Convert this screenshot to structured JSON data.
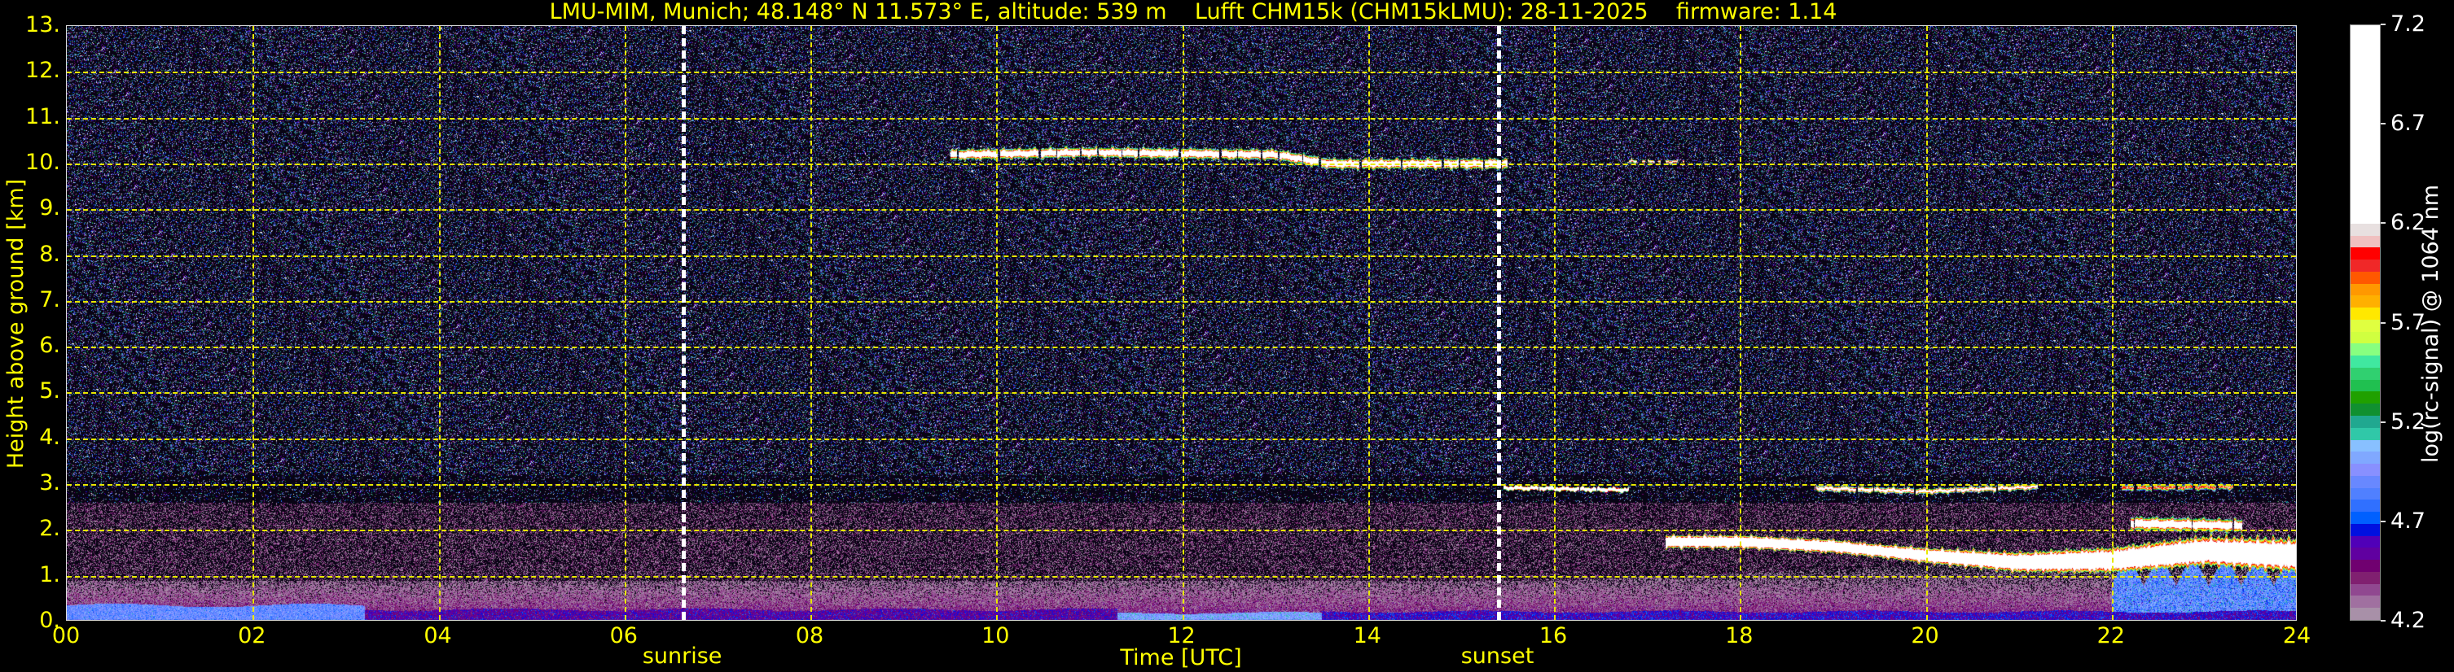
{
  "title": "LMU-MIM, Munich; 48.148° N 11.573° E, altitude: 539 m    Lufft CHM15k (CHM15kLMU): 28-11-2025    firmware: 1.14",
  "chart_data": {
    "type": "heatmap",
    "xlabel": "Time [UTC]",
    "ylabel": "Height above ground [km]",
    "colorbar_label": "log(rc-signal) @ 1064 nm",
    "xlim": [
      0,
      24
    ],
    "ylim": [
      0,
      13
    ],
    "clim": [
      4.2,
      7.2
    ],
    "x_ticks": [
      "00",
      "02",
      "04",
      "06",
      "08",
      "10",
      "12",
      "14",
      "16",
      "18",
      "20",
      "22",
      "24"
    ],
    "x_tick_values": [
      0,
      2,
      4,
      6,
      8,
      10,
      12,
      14,
      16,
      18,
      20,
      22,
      24
    ],
    "y_ticks": [
      "0.",
      "1.",
      "2.",
      "3.",
      "4.",
      "5.",
      "6.",
      "7.",
      "8.",
      "9.",
      "10.",
      "11.",
      "12.",
      "13."
    ],
    "y_tick_values": [
      0,
      1,
      2,
      3,
      4,
      5,
      6,
      7,
      8,
      9,
      10,
      11,
      12,
      13
    ],
    "colorbar_ticks": [
      "4.2",
      "4.7",
      "5.2",
      "5.7",
      "6.2",
      "6.7",
      "7.2"
    ],
    "colorbar_tick_values": [
      4.2,
      4.7,
      5.2,
      5.7,
      6.2,
      6.7,
      7.2
    ],
    "grid": true,
    "markers": [
      {
        "label": "sunrise",
        "time": 6.63
      },
      {
        "label": "sunset",
        "time": 15.4
      }
    ],
    "colormap": [
      "#a890a8",
      "#a070a0",
      "#904890",
      "#802070",
      "#700070",
      "#6000a0",
      "#5000b8",
      "#0010e0",
      "#0060ff",
      "#3070ff",
      "#5080ff",
      "#6888ff",
      "#8890ff",
      "#80a8ff",
      "#88c0ff",
      "#30c8a8",
      "#20a890",
      "#109030",
      "#20a000",
      "#20c050",
      "#30d070",
      "#40e8a0",
      "#88ff80",
      "#d0ff40",
      "#e0ff40",
      "#ffe800",
      "#ffb000",
      "#ff9800",
      "#ff5800",
      "#f02828",
      "#ff0000",
      "#f0c0c0",
      "#e8e0e0",
      "#ffffff"
    ],
    "colormap_white_from": 6.2,
    "boundary_layer": [
      {
        "start": 0,
        "end": 3.2,
        "top_km": 0.4,
        "value": 4.9
      },
      {
        "start": 3.2,
        "end": 11.3,
        "top_km": 0.3,
        "value": 4.55
      },
      {
        "start": 11.3,
        "end": 13.5,
        "top_km": 0.22,
        "value": 5.0
      },
      {
        "start": 13.5,
        "end": 24,
        "top_km": 0.25,
        "value": 4.6
      }
    ],
    "cloud_layers": [
      {
        "name": "cirrus",
        "points": [
          [
            9.5,
            10.2
          ],
          [
            11,
            10.25
          ],
          [
            13,
            10.2
          ],
          [
            13.6,
            10.0
          ],
          [
            15.5,
            10.0
          ]
        ],
        "thickness_km": 0.28,
        "peak": 6.6,
        "coverage": 0.85
      },
      {
        "name": "cirrus-patch",
        "points": [
          [
            16.8,
            10.05
          ],
          [
            17.4,
            10.05
          ]
        ],
        "thickness_km": 0.1,
        "peak": 6.3,
        "coverage": 0.5
      },
      {
        "name": "low-cloud-3km",
        "points": [
          [
            15.45,
            2.93
          ],
          [
            16.8,
            2.88
          ]
        ],
        "thickness_km": 0.12,
        "peak": 6.9,
        "coverage": 0.9
      },
      {
        "name": "stratocumulus",
        "points": [
          [
            17.2,
            1.75
          ],
          [
            18,
            1.75
          ],
          [
            19,
            1.65
          ],
          [
            20,
            1.45
          ],
          [
            21,
            1.3
          ],
          [
            22,
            1.35
          ],
          [
            23,
            1.55
          ],
          [
            24,
            1.45
          ]
        ],
        "thickness_km": 0.35,
        "peak": 7.0,
        "coverage": 1.0
      },
      {
        "name": "altocumulus-1",
        "points": [
          [
            18.8,
            2.92
          ],
          [
            20,
            2.85
          ],
          [
            21.2,
            2.95
          ]
        ],
        "thickness_km": 0.16,
        "peak": 6.4,
        "coverage": 0.9
      },
      {
        "name": "altocumulus-2",
        "points": [
          [
            22.1,
            2.92
          ],
          [
            23.3,
            2.95
          ]
        ],
        "thickness_km": 0.16,
        "peak": 6.1,
        "coverage": 0.8
      },
      {
        "name": "cumulus-2km",
        "points": [
          [
            22.2,
            2.15
          ],
          [
            23.4,
            2.1
          ]
        ],
        "thickness_km": 0.35,
        "peak": 6.6,
        "coverage": 0.9
      }
    ],
    "precipitation": [
      {
        "start": 22.0,
        "end": 24.0,
        "top_km": 1.3,
        "value": 4.9
      }
    ]
  }
}
